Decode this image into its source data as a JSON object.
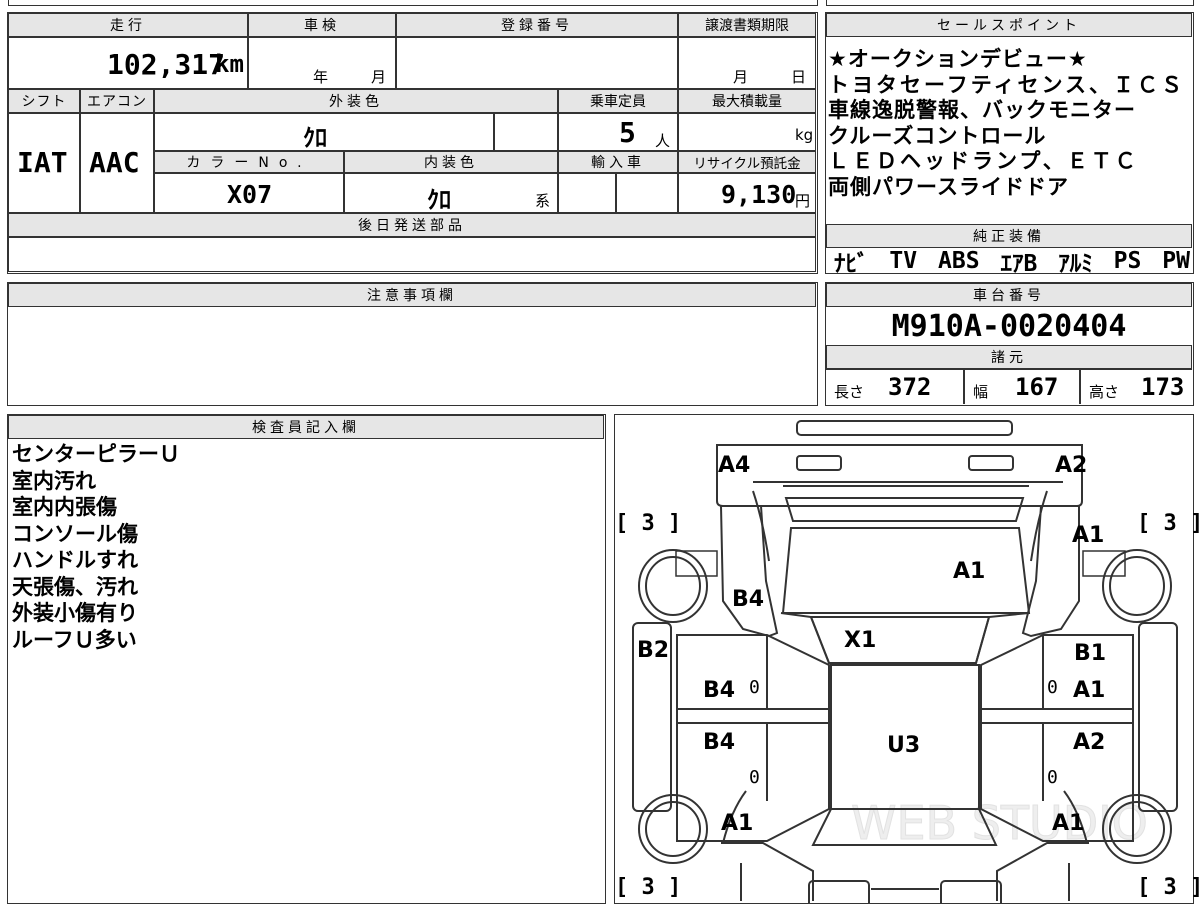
{
  "main_info": {
    "mileage_label": "走行",
    "mileage_value": "102,317",
    "mileage_unit": "km",
    "inspection_label": "車検",
    "inspection_year_unit": "年",
    "inspection_month_unit": "月",
    "registration_label": "登録番号",
    "transfer_deadline_label": "譲渡書類期限",
    "transfer_month_unit": "月",
    "transfer_day_unit": "日",
    "shift_label": "シフト",
    "shift_value": "IAT",
    "aircon_label": "エアコン",
    "aircon_value": "AAC",
    "exterior_color_label": "外装色",
    "exterior_color_value": "ｸﾛ",
    "capacity_label": "乗車定員",
    "capacity_value": "5",
    "capacity_unit": "人",
    "max_load_label": "最大積載量",
    "max_load_unit": "kg",
    "color_no_label": "カラーNo.",
    "color_no_value": "X07",
    "interior_color_label": "内装色",
    "interior_color_value": "ｸﾛ",
    "interior_color_suffix": "系",
    "import_label": "輸入車",
    "recycle_label": "リサイクル預託金",
    "recycle_value": "9,130",
    "recycle_unit": "円",
    "later_parts_label": "後日発送部品"
  },
  "sales_points": {
    "label": "セールスポイント",
    "lines": [
      "★オークションデビュー★",
      "トヨタセーフティセンス、ＩＣＳ",
      "車線逸脱警報、バックモニター",
      "クルーズコントロール",
      "ＬＥＤヘッドランプ、ＥＴＣ",
      "両側パワースライドドア"
    ]
  },
  "genuine_equipment": {
    "label": "純正装備",
    "items": [
      "ﾅﾋﾞ",
      "TV",
      "ABS",
      "ｴｱB",
      "ｱﾙﾐ",
      "PS",
      "PW"
    ]
  },
  "caution": {
    "label": "注意事項欄"
  },
  "chassis": {
    "label": "車台番号",
    "value": "M910A-0020404"
  },
  "specs": {
    "label": "諸元",
    "length_label": "長さ",
    "length_value": "372",
    "width_label": "幅",
    "width_value": "167",
    "height_label": "高さ",
    "height_value": "173"
  },
  "inspector": {
    "label": "検査員記入欄",
    "notes": [
      "センターピラーＵ",
      "室内汚れ",
      "室内内張傷",
      "コンソール傷",
      "ハンドルすれ",
      "天張傷、汚れ",
      "外装小傷有り",
      "ルーフＵ多い"
    ]
  },
  "diagram": {
    "marks": {
      "a4_front_left": "A4",
      "a2_front_right": "A2",
      "a1_right_front_fender": "A1",
      "a1_hood": "A1",
      "b4_left_front": "B4",
      "x1_windshield": "X1",
      "b2_left_side": "B2",
      "b1_right_side": "B1",
      "b4_left_front_door": "B4",
      "a1_right_front_door": "A1",
      "b4_left_rear_door": "B4",
      "u3_roof": "U3",
      "a2_right_rear_door": "A2",
      "a1_left_rear": "A1",
      "a1_right_rear": "A1"
    },
    "tire_brackets": {
      "front_left": "[ 3 ]",
      "front_right": "[ 3 ]",
      "rear_left": "[ 3 ]",
      "rear_right": "[ 3 ]"
    },
    "door_zeros": [
      "0",
      "0",
      "0",
      "0"
    ],
    "watermark": "WEB STUDIO"
  }
}
